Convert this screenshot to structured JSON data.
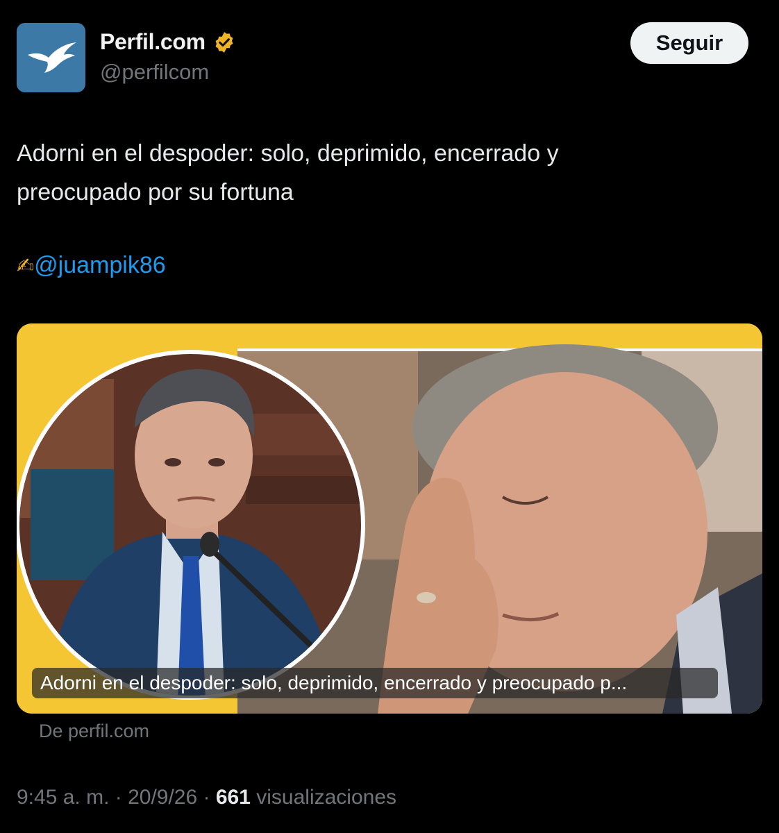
{
  "account": {
    "display_name": "Perfil.com",
    "handle": "@perfilcom",
    "avatar_icon": "bird-logo-icon",
    "verified_icon": "verified-badge-icon",
    "verified_color": "#f0b429",
    "avatar_color": "#3d79a6"
  },
  "follow_button": {
    "label": "Seguir"
  },
  "tweet": {
    "text_line_1": "Adorni en el despoder: solo, deprimido, encerrado y",
    "text_line_2": "preocupado por su fortuna",
    "credit_icon": "writing-hand-icon",
    "credit_emoji": "✍",
    "mention": "@juampik86"
  },
  "card": {
    "caption": "Adorni en el despoder: solo, deprimido, encerrado y preocupado p...",
    "source": "De perfil.com",
    "background_color": "#f4c634"
  },
  "meta": {
    "time": "9:45 a. m.",
    "separator": " · ",
    "date": "20/9/26",
    "views_count": "661",
    "views_label": "visualizaciones"
  },
  "colors": {
    "background": "#000000",
    "text": "#e7e9ea",
    "muted": "#71767b",
    "link": "#1d9bf0"
  }
}
